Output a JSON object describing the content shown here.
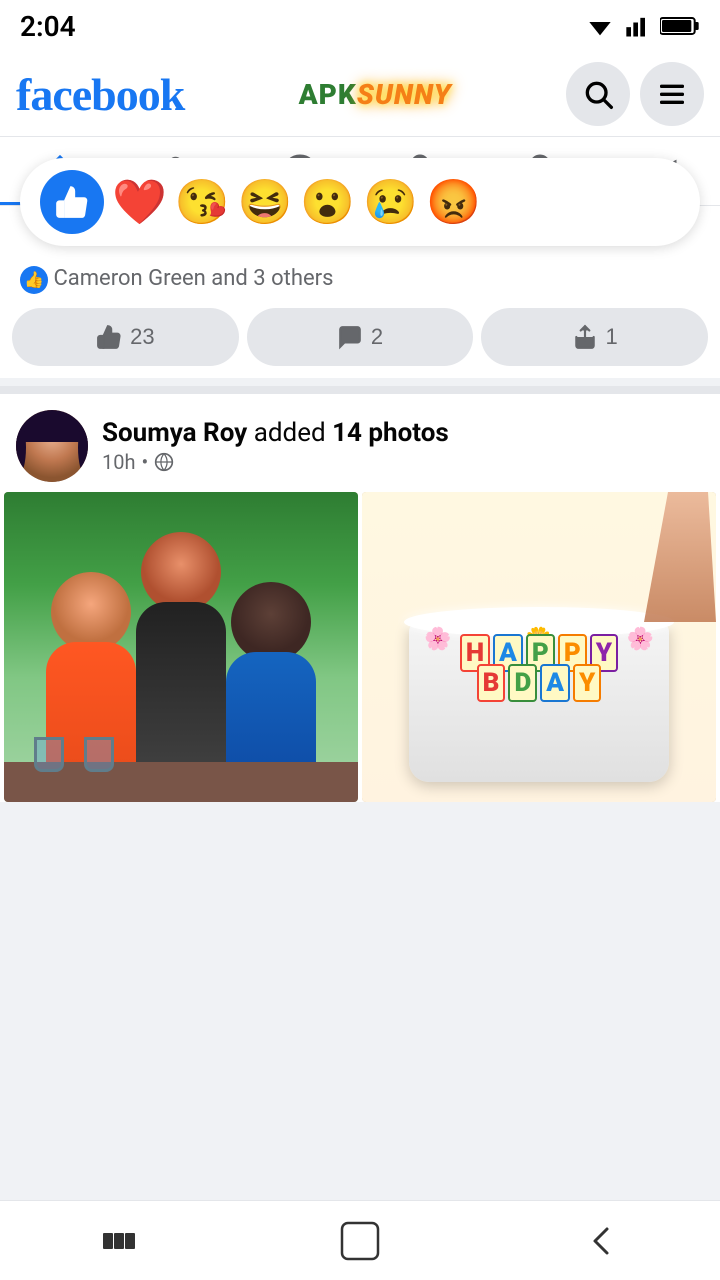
{
  "statusBar": {
    "time": "2:04",
    "wifiIcon": "wifi-icon",
    "signalIcon": "signal-icon",
    "batteryIcon": "battery-icon"
  },
  "header": {
    "logo": "facebook",
    "apksunny": {
      "apk": "APK",
      "sunny": "SUNNY"
    },
    "searchLabel": "search",
    "menuLabel": "menu"
  },
  "nav": {
    "items": [
      {
        "id": "home",
        "label": "Home",
        "active": true
      },
      {
        "id": "friends",
        "label": "Friends",
        "active": false
      },
      {
        "id": "messenger",
        "label": "Messenger",
        "active": false
      },
      {
        "id": "marketplace",
        "label": "Marketplace",
        "active": false
      },
      {
        "id": "notifications",
        "label": "Notifications",
        "active": false
      },
      {
        "id": "video",
        "label": "Video",
        "active": false
      }
    ]
  },
  "posts": [
    {
      "id": "post1",
      "reactions": {
        "emojis": [
          "👍",
          "❤️",
          "😘",
          "😆",
          "😮",
          "😢",
          "😡"
        ],
        "likers": "Cameron Green and 3 others",
        "count": 23,
        "comments": 2,
        "shares": 1
      },
      "actionLabels": {
        "like": "23",
        "comment": "2",
        "share": "1"
      }
    },
    {
      "id": "post2",
      "author": "Soumya Roy",
      "action": "added",
      "photoCount": "14 photos",
      "time": "10h",
      "privacy": "public",
      "avatar": "soumya-roy-avatar"
    }
  ],
  "reactions": {
    "like": "👍",
    "love": "❤️",
    "haha": "😆",
    "wow": "😮",
    "sad": "😢",
    "angry": "😡",
    "kiss": "😘"
  },
  "bottomNav": {
    "back": "‹",
    "home": "○",
    "recents": "▮▮▮"
  }
}
